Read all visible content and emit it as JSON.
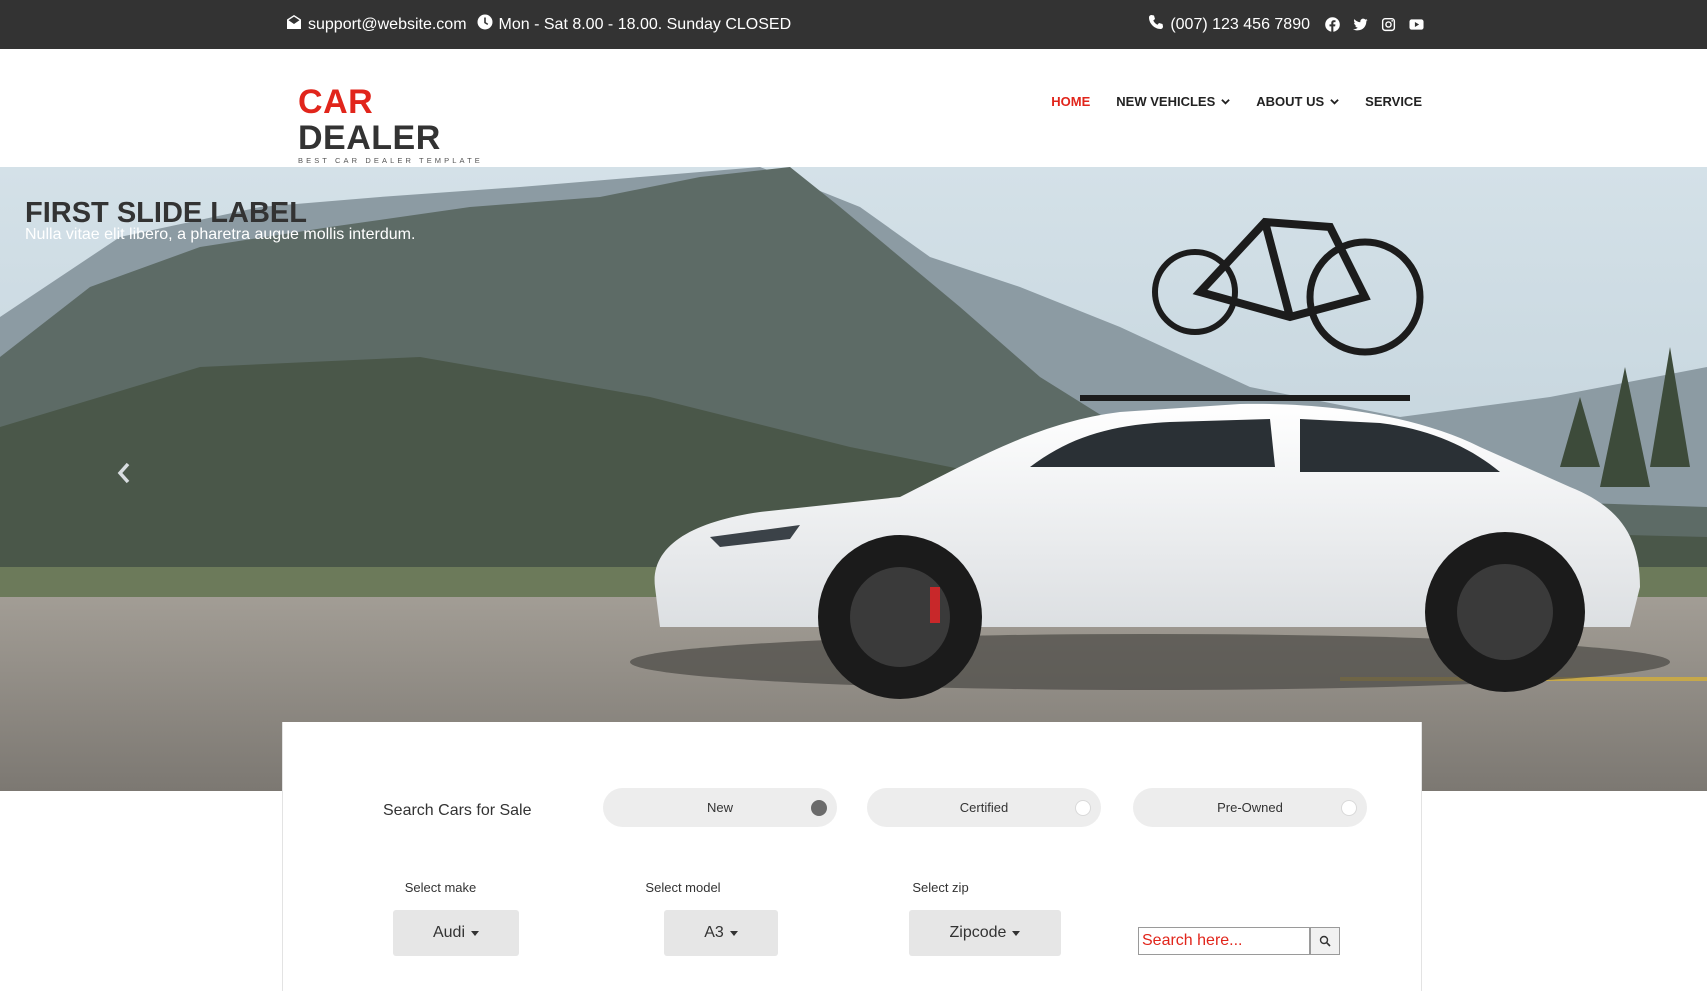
{
  "topbar": {
    "email": "support@website.com",
    "hours": "Mon - Sat 8.00 - 18.00. Sunday CLOSED",
    "phone": "(007) 123 456 7890",
    "social_icons": [
      "facebook-icon",
      "twitter-icon",
      "instagram-icon",
      "youtube-icon"
    ]
  },
  "logo": {
    "word_part1": "C",
    "word_accent": "A",
    "word_part2": "R",
    "word_part3": " DEALER",
    "tagline": "BEST CAR DEALER TEMPLATE"
  },
  "nav": {
    "items": [
      {
        "label": "HOME",
        "active": true,
        "dropdown": false
      },
      {
        "label": "NEW VEHICLES",
        "active": false,
        "dropdown": true
      },
      {
        "label": "ABOUT US",
        "active": false,
        "dropdown": true
      },
      {
        "label": "SERVICE",
        "active": false,
        "dropdown": false
      }
    ]
  },
  "hero": {
    "title": "FIRST SLIDE LABEL",
    "subtitle": "Nulla vitae elit libero, a pharetra augue mollis interdum."
  },
  "search": {
    "title": "Search Cars for Sale",
    "conditions": [
      {
        "label": "New",
        "selected": true
      },
      {
        "label": "Certified",
        "selected": false
      },
      {
        "label": "Pre-Owned",
        "selected": false
      }
    ],
    "make": {
      "label": "Select make",
      "value": "Audi"
    },
    "model": {
      "label": "Select model",
      "value": "A3"
    },
    "zip": {
      "label": "Select zip",
      "value": "Zipcode"
    },
    "input_placeholder": "Search here..."
  },
  "colors": {
    "accent": "#e1251b",
    "topbar_bg": "#333333",
    "pill_bg": "#ededed"
  }
}
